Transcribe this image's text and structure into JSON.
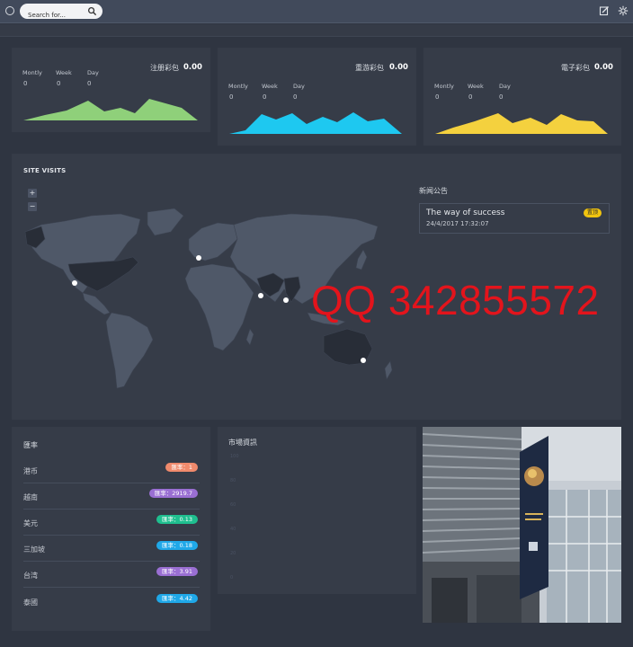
{
  "topbar": {
    "search_placeholder": "Search for...",
    "icons": [
      "clock-icon",
      "search-icon",
      "edit-icon",
      "settings-icon"
    ]
  },
  "stats": [
    {
      "title": "注册彩包",
      "value": "0.00",
      "labels": [
        "Montly",
        "Week",
        "Day"
      ],
      "numbers": [
        "0",
        "0",
        "0"
      ],
      "color": "#8fd07a"
    },
    {
      "title": "重游彩包",
      "value": "0.00",
      "labels": [
        "Montly",
        "Week",
        "Day"
      ],
      "numbers": [
        "0",
        "0",
        "0"
      ],
      "color": "#1ec8f0"
    },
    {
      "title": "電子彩包",
      "value": "0.00",
      "labels": [
        "Montly",
        "Week",
        "Day"
      ],
      "numbers": [
        "0",
        "0",
        "0"
      ],
      "color": "#f4d13e"
    }
  ],
  "visits": {
    "title": "SITE VISITS",
    "zoom_in": "+",
    "zoom_out": "−"
  },
  "notice": {
    "title": "新闻公告",
    "item_text": "The way of success",
    "item_date": "24/4/2017 17:32:07",
    "item_badge": "置顶"
  },
  "watermark": "QQ 342855572",
  "rates": {
    "title": "匯率",
    "rows": [
      {
        "name": "港币",
        "badge": "匯率：1",
        "color": "#f08a6c"
      },
      {
        "name": "越南",
        "badge": "匯率：2919.7",
        "color": "#9a6fd3"
      },
      {
        "name": "美元",
        "badge": "匯率：0.13",
        "color": "#1fbf8f"
      },
      {
        "name": "三加坡",
        "badge": "匯率：0.18",
        "color": "#1fa8e8"
      },
      {
        "name": "台湾",
        "badge": "匯率：3.91",
        "color": "#9a6fd3"
      },
      {
        "name": "泰國",
        "badge": "匯率：4.42",
        "color": "#1fa8e8"
      }
    ]
  },
  "news": {
    "title": "市場資訊",
    "ticks": [
      "100",
      "80",
      "60",
      "40",
      "20",
      "0"
    ]
  }
}
